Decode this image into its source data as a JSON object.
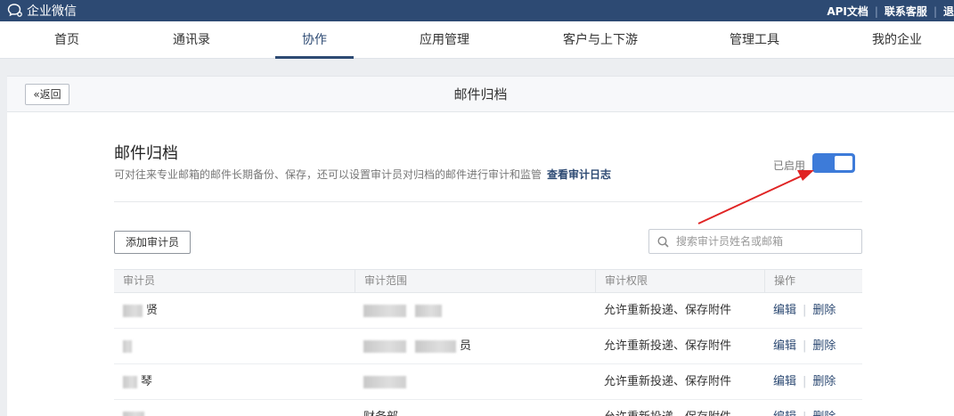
{
  "topbar": {
    "logo_text": "企业微信",
    "links": [
      "API文档",
      "联系客服",
      "退"
    ]
  },
  "nav": {
    "items": [
      "首页",
      "通讯录",
      "协作",
      "应用管理",
      "客户与上下游",
      "管理工具",
      "我的企业"
    ],
    "active": "协作"
  },
  "panel": {
    "back_label": "«返回",
    "title": "邮件归档"
  },
  "section": {
    "title": "邮件归档",
    "description": "可对往来专业邮箱的邮件长期备份、保存，还可以设置审计员对归档的邮件进行审计和监管",
    "log_link": "查看审计日志",
    "status_label": "已启用",
    "enabled": true
  },
  "toolbar": {
    "add_label": "添加审计员",
    "search_placeholder": "搜索审计员姓名或邮箱"
  },
  "table": {
    "columns": [
      "审计员",
      "审计范围",
      "审计权限",
      "操作"
    ],
    "rows": [
      {
        "auditor": "贤",
        "scope": "",
        "permission": "允许重新投递、保存附件"
      },
      {
        "auditor": "",
        "scope": "员",
        "permission": "允许重新投递、保存附件"
      },
      {
        "auditor": "琴",
        "scope": "",
        "permission": "允许重新投递、保存附件"
      },
      {
        "auditor": "",
        "scope": "财务部",
        "permission": "允许重新投递、保存附件"
      }
    ],
    "edit_label": "编辑",
    "delete_label": "删除"
  },
  "colors": {
    "brand": "#2d4a73",
    "toggle_on": "#3d7bd9",
    "annotation_arrow": "#e02424"
  }
}
